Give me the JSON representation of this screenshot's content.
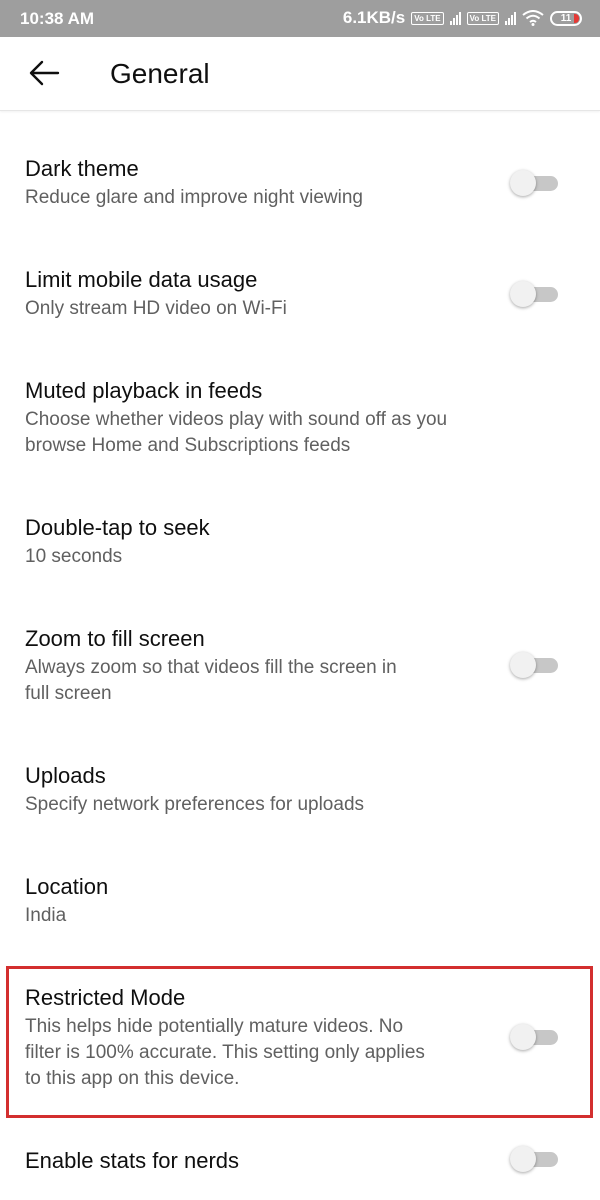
{
  "status_bar": {
    "time": "10:38 AM",
    "network_speed": "6.1KB/s",
    "volte1": "Vo LTE",
    "volte2": "Vo LTE",
    "battery": "11"
  },
  "header": {
    "title": "General",
    "back_icon": "arrow-left-icon"
  },
  "settings": [
    {
      "title": "Dark theme",
      "subtitle": "Reduce glare and improve night viewing",
      "toggle": false
    },
    {
      "title": "Limit mobile data usage",
      "subtitle": "Only stream HD video on Wi-Fi",
      "toggle": false
    },
    {
      "title": "Muted playback in feeds",
      "subtitle_lines": [
        "Choose whether videos play with sound off as you",
        "browse Home and Subscriptions feeds"
      ]
    },
    {
      "title": "Double-tap to seek",
      "subtitle": "10 seconds"
    },
    {
      "title": "Zoom to fill screen",
      "subtitle_lines": [
        "Always zoom so that videos fill the screen in",
        "full screen"
      ],
      "toggle": false
    },
    {
      "title": "Uploads",
      "subtitle": "Specify network preferences for uploads"
    },
    {
      "title": "Location",
      "subtitle": "India"
    },
    {
      "title": "Restricted Mode",
      "subtitle_lines": [
        "This helps hide potentially mature videos. No",
        "filter is 100% accurate. This setting only applies",
        "to this app on this device."
      ],
      "toggle": false,
      "highlighted": true
    },
    {
      "title": "Enable stats for nerds",
      "toggle": false
    }
  ],
  "colors": {
    "highlight": "#d32f2f",
    "statusbar": "#9e9e9e",
    "battery_low": "#e53935"
  }
}
